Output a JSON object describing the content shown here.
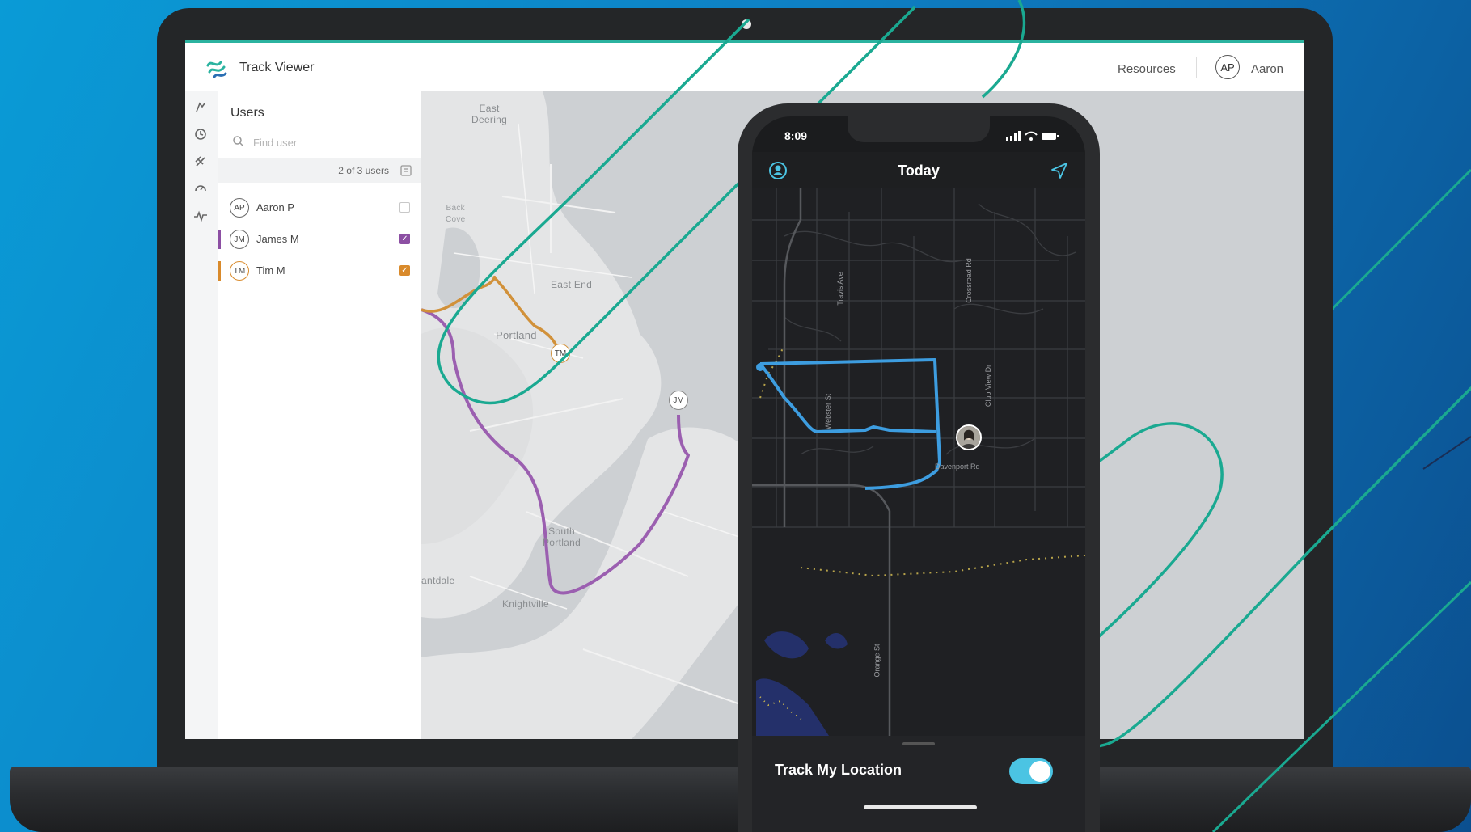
{
  "app": {
    "title": "Track Viewer",
    "header": {
      "resources": "Resources",
      "user_initials": "AP",
      "user_name": "Aaron"
    }
  },
  "rail": {
    "icons": [
      "tracks-icon",
      "history-icon",
      "satellite-icon",
      "speed-icon",
      "activity-icon"
    ]
  },
  "users_panel": {
    "title": "Users",
    "search_placeholder": "Find user",
    "count_text": "2 of 3 users",
    "users": [
      {
        "initials": "AP",
        "name": "Aaron P",
        "checked": false,
        "color": ""
      },
      {
        "initials": "JM",
        "name": "James M",
        "checked": true,
        "color": "#8c4fa3"
      },
      {
        "initials": "TM",
        "name": "Tim M",
        "checked": true,
        "color": "#d98a2b"
      }
    ]
  },
  "map": {
    "labels": {
      "east_deering": "East\nDeering",
      "back_cove": "Back\nCove",
      "east_end": "East End",
      "portland": "Portland",
      "south_portland": "South\nPortland",
      "knightville": "Knightville",
      "ferry_village_partial": "antdale"
    },
    "markers": {
      "tm": "TM",
      "jm": "JM"
    },
    "track_colors": {
      "james": "#9b5fb0",
      "tim": "#d1913a"
    }
  },
  "phone": {
    "status_time": "8:09",
    "nav_title": "Today",
    "street_labels": [
      "Travis Ave",
      "Crossroad Rd",
      "Webster St",
      "Club View Dr",
      "Davenport Rd",
      "Orange St"
    ],
    "track_color": "#3d9de0",
    "track_my_location_label": "Track My Location",
    "toggle_on": true
  },
  "colors": {
    "accent_teal": "#2bb3a0",
    "background_blue": "#0e7fc4"
  }
}
